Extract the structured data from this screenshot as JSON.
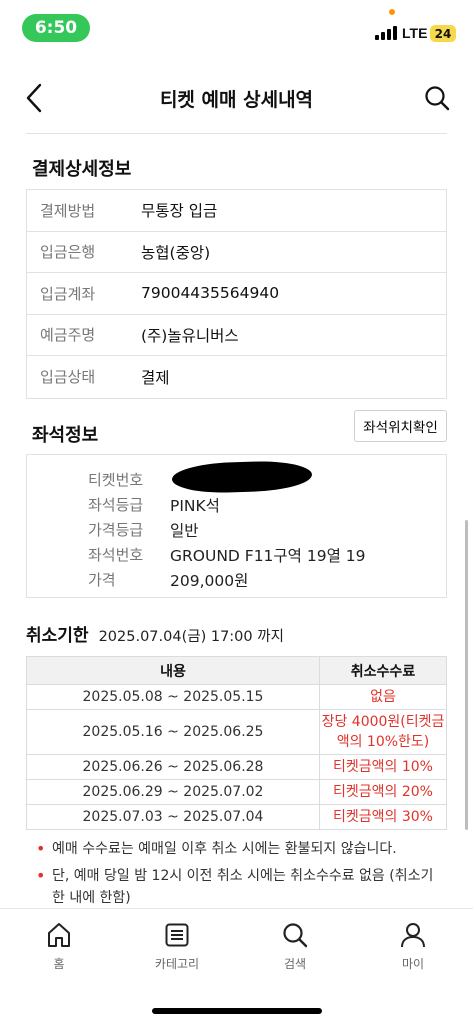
{
  "status_bar": {
    "time": "6:50",
    "network": "LTE",
    "battery": "24"
  },
  "header": {
    "title": "티켓 예매 상세내역"
  },
  "payment": {
    "title": "결제상세정보",
    "rows": [
      {
        "label": "결제방법",
        "value": "무통장 입금"
      },
      {
        "label": "입금은행",
        "value": "농협(중앙)"
      },
      {
        "label": "입금계좌",
        "value": "79004435564940"
      },
      {
        "label": "예금주명",
        "value": "(주)놀유니버스"
      },
      {
        "label": "입금상태",
        "value": "결제"
      }
    ]
  },
  "seat": {
    "title": "좌석정보",
    "map_button": "좌석위치확인",
    "rows": [
      {
        "label": "티켓번호",
        "value": ""
      },
      {
        "label": "좌석등급",
        "value": "PINK석"
      },
      {
        "label": "가격등급",
        "value": "일반"
      },
      {
        "label": "좌석번호",
        "value": "GROUND F11구역 19열 19"
      },
      {
        "label": "가격",
        "value": "209,000원"
      }
    ]
  },
  "cancel": {
    "title": "취소기한",
    "deadline": "2025.07.04(금) 17:00 까지",
    "headers": [
      "내용",
      "취소수수료"
    ],
    "rows": [
      {
        "period": "2025.05.08 ~ 2025.05.15",
        "fee": "없음"
      },
      {
        "period": "2025.05.16 ~ 2025.06.25",
        "fee": "장당 4000원(티켓금액의 10%한도)"
      },
      {
        "period": "2025.06.26 ~ 2025.06.28",
        "fee": "티켓금액의 10%"
      },
      {
        "period": "2025.06.29 ~ 2025.07.02",
        "fee": "티켓금액의 20%"
      },
      {
        "period": "2025.07.03 ~ 2025.07.04",
        "fee": "티켓금액의 30%"
      }
    ],
    "notes": [
      "예매 수수료는 예매일 이후 취소 시에는 환불되지 않습니다.",
      "단, 예매 당일 밤 12시 이전 취소 시에는 취소수수료 없음 (취소기한 내에 한함)"
    ]
  },
  "bottom_nav": {
    "items": [
      {
        "label": "홈",
        "icon": "home-icon"
      },
      {
        "label": "카테고리",
        "icon": "list-icon"
      },
      {
        "label": "검색",
        "icon": "search-icon"
      },
      {
        "label": "마이",
        "icon": "person-icon"
      }
    ]
  },
  "colors": {
    "accent_red": "#e0332b",
    "status_green": "#34c759",
    "battery_yellow": "#f7d84a"
  }
}
